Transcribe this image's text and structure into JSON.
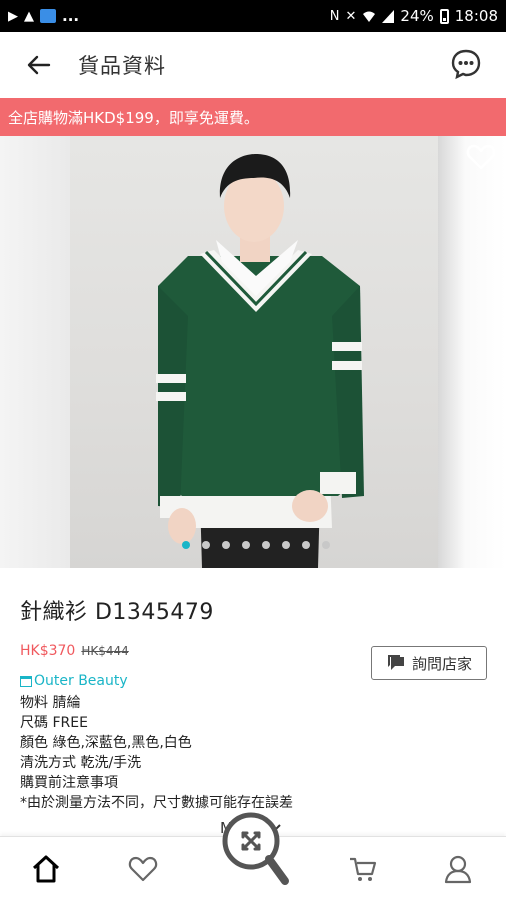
{
  "status_bar": {
    "left_icons": [
      "navigation-icon",
      "warning-icon",
      "app-icon",
      "more-dots"
    ],
    "left_more": "...",
    "right_icons": [
      "nfc-icon",
      "mute-icon",
      "wifi-icon",
      "signal-icon"
    ],
    "battery_percent": "24%",
    "time": "18:08"
  },
  "header": {
    "title": "貨品資料",
    "back_icon": "arrow-left-icon",
    "chat_icon": "chat-bubble-icon"
  },
  "promo": {
    "text": "全店購物滿HKD$199，即享免運費。"
  },
  "gallery": {
    "image_count": 8,
    "active_index": 0,
    "colors": {
      "active_dot": "#1ab5c7",
      "inactive_dot": "#c8c8c8"
    }
  },
  "product": {
    "name": "針織衫 D1345479",
    "price_now": "HK$370",
    "price_old": "HK$444",
    "shop_name": "Outer Beauty",
    "specs": [
      "物料 腈綸",
      "尺碼 FREE",
      "顏色 綠色,深藍色,黑色,白色",
      "清洗方式 乾洗/手洗",
      "購買前注意事項",
      "*由於測量方法不同，尺寸數據可能存在誤差"
    ]
  },
  "actions": {
    "ask_shop_label": "詢問店家",
    "more_label": "More"
  },
  "bottom_nav": {
    "items": [
      "home-icon",
      "heart-icon",
      "search-icon",
      "cart-icon",
      "profile-icon"
    ],
    "active": "home-icon"
  },
  "colors": {
    "accent": "#1ab5c7",
    "promo": "#f26a6e",
    "price": "#f0595e"
  }
}
